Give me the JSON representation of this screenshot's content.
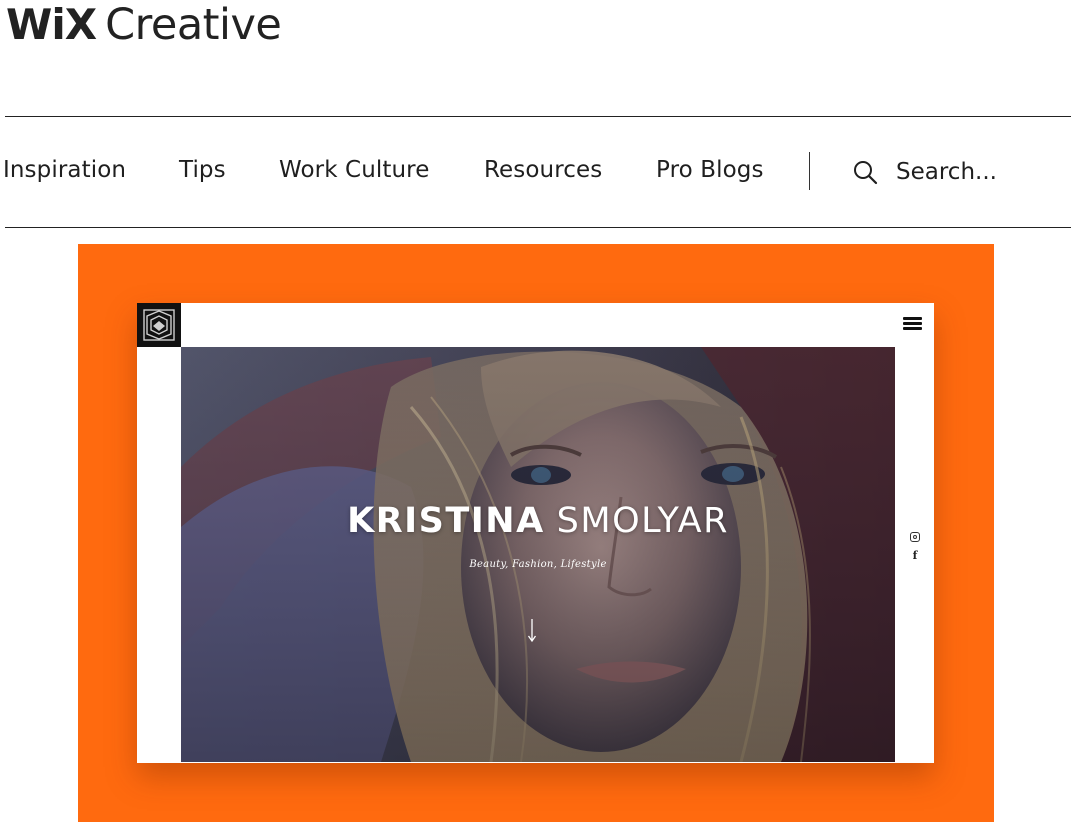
{
  "brand": {
    "wordmark": "WiX",
    "product": "Creative"
  },
  "nav": {
    "items": [
      {
        "label": "Inspiration"
      },
      {
        "label": "Tips"
      },
      {
        "label": "Work Culture"
      },
      {
        "label": "Resources"
      },
      {
        "label": "Pro Blogs"
      }
    ],
    "search_label": "Search..."
  },
  "hero": {
    "background_color": "#ff6a0f",
    "site_preview": {
      "headline_first": "KRISTINA",
      "headline_last": "SMOLYAR",
      "tagline": "Beauty, Fashion, Lifestyle",
      "icons": [
        "site-logo-icon",
        "menu-icon",
        "instagram-icon",
        "facebook-icon",
        "arrow-down-icon"
      ]
    }
  }
}
